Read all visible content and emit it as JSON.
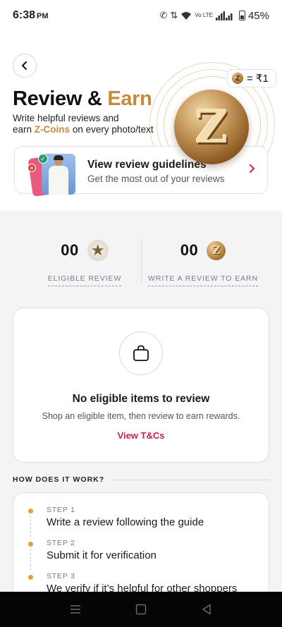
{
  "status_bar": {
    "time": "6:38",
    "meridiem": "PM",
    "network_label": "Vo LTE",
    "battery": "45%"
  },
  "header": {
    "coin_rate": "= ₹1",
    "coin_letter": "Z",
    "title_part1": "Review &",
    "title_part2": "Earn",
    "subtitle_line1": "Write helpful reviews and",
    "subtitle_earn": "earn",
    "subtitle_coins": "Z-Coins",
    "subtitle_rest": "on every photo/text"
  },
  "guidelines_card": {
    "title": "View review guidelines",
    "subtitle": "Get the most out of your reviews"
  },
  "stats": {
    "eligible": {
      "count": "00",
      "label": "ELIGIBLE REVIEW"
    },
    "write": {
      "count": "00",
      "label": "WRITE A REVIEW TO EARN"
    }
  },
  "empty_state": {
    "title": "No eligible items to review",
    "subtitle": "Shop an eligible item, then review to earn rewards.",
    "link": "View T&Cs"
  },
  "how_it_works": {
    "heading": "HOW DOES IT WORK?",
    "steps": [
      {
        "num": "STEP 1",
        "text": "Write a review following the guide"
      },
      {
        "num": "STEP 2",
        "text": "Submit it for verification"
      },
      {
        "num": "STEP 3",
        "text": "We verify if it’s helpful for other shoppers"
      }
    ]
  },
  "colors": {
    "accent_gold": "#c68a3a",
    "link_red": "#c3234d",
    "step_dot": "#e2a23a"
  },
  "icons": [
    "back-arrow-icon",
    "coin-icon",
    "star-icon",
    "shopping-bag-icon",
    "chevron-right-icon",
    "recents-icon",
    "home-icon",
    "back-icon"
  ]
}
